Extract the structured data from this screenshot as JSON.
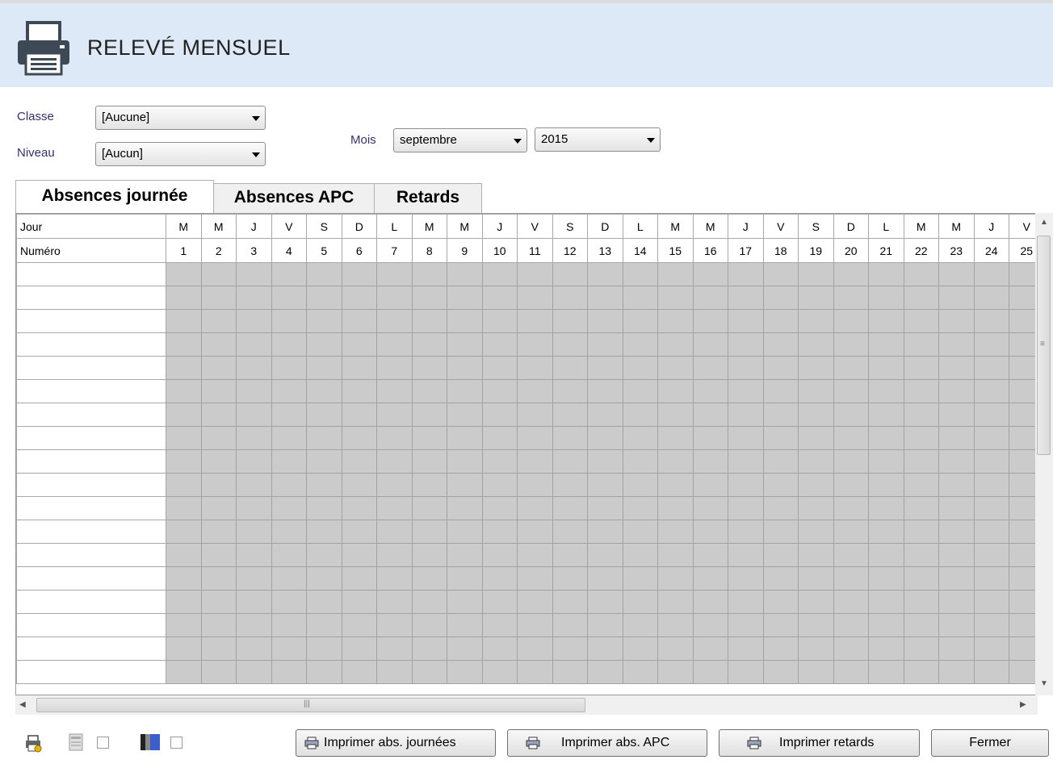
{
  "header": {
    "title": "RELEVÉ MENSUEL",
    "icon": "printer-icon"
  },
  "filters": {
    "classe_label": "Classe",
    "classe_value": "[Aucune]",
    "niveau_label": "Niveau",
    "niveau_value": "[Aucun]",
    "mois_label": "Mois",
    "mois_value": "septembre",
    "annee_value": "2015"
  },
  "tabs": [
    {
      "label": "Absences journée",
      "active": true
    },
    {
      "label": "Absences APC",
      "active": false
    },
    {
      "label": "Retards",
      "active": false
    }
  ],
  "grid": {
    "row1_label": "Jour",
    "row2_label": "Numéro",
    "days": [
      "M",
      "M",
      "J",
      "V",
      "S",
      "D",
      "L",
      "M",
      "M",
      "J",
      "V",
      "S",
      "D",
      "L",
      "M",
      "M",
      "J",
      "V",
      "S",
      "D",
      "L",
      "M",
      "M",
      "J",
      "V"
    ],
    "numbers": [
      "1",
      "2",
      "3",
      "4",
      "5",
      "6",
      "7",
      "8",
      "9",
      "10",
      "11",
      "12",
      "13",
      "14",
      "15",
      "16",
      "17",
      "18",
      "19",
      "20",
      "21",
      "22",
      "23",
      "24",
      "25"
    ],
    "empty_rows": 18
  },
  "buttons": {
    "print_days": "Imprimer abs. journées",
    "print_apc": "Imprimer abs. APC",
    "print_late": "Imprimer retards",
    "close": "Fermer"
  },
  "footer_icons": [
    "settings-printer-icon",
    "pdf-icon",
    "color-icon"
  ]
}
